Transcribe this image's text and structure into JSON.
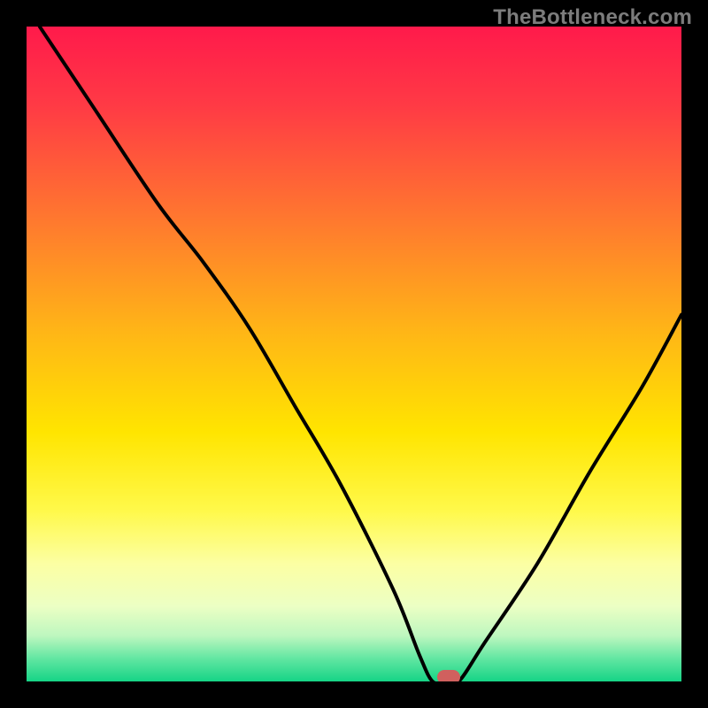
{
  "watermark": "TheBottleneck.com",
  "chart_data": {
    "type": "line",
    "title": "",
    "xlabel": "",
    "ylabel": "",
    "xlim": [
      0,
      100
    ],
    "ylim": [
      0,
      100
    ],
    "grid": false,
    "series": [
      {
        "name": "curve",
        "x": [
          2,
          10,
          20,
          27,
          34,
          41,
          48,
          56,
          60,
          62,
          64,
          66,
          70,
          78,
          86,
          94,
          100
        ],
        "y": [
          100,
          88,
          73,
          64,
          54,
          42,
          30,
          14,
          4,
          0,
          0,
          0,
          6,
          18,
          32,
          45,
          56
        ]
      }
    ],
    "marker": {
      "x": 64.5,
      "y": 0
    },
    "background_gradient": {
      "stops": [
        {
          "pos": 0,
          "color": "#ff1a4b"
        },
        {
          "pos": 0.12,
          "color": "#ff3a45"
        },
        {
          "pos": 0.3,
          "color": "#ff7a2e"
        },
        {
          "pos": 0.47,
          "color": "#ffb716"
        },
        {
          "pos": 0.62,
          "color": "#ffe500"
        },
        {
          "pos": 0.74,
          "color": "#fff94b"
        },
        {
          "pos": 0.82,
          "color": "#fcffa3"
        },
        {
          "pos": 0.885,
          "color": "#ecffc4"
        },
        {
          "pos": 0.93,
          "color": "#bef7bf"
        },
        {
          "pos": 0.965,
          "color": "#62e6a2"
        },
        {
          "pos": 1.0,
          "color": "#16d486"
        }
      ]
    }
  }
}
